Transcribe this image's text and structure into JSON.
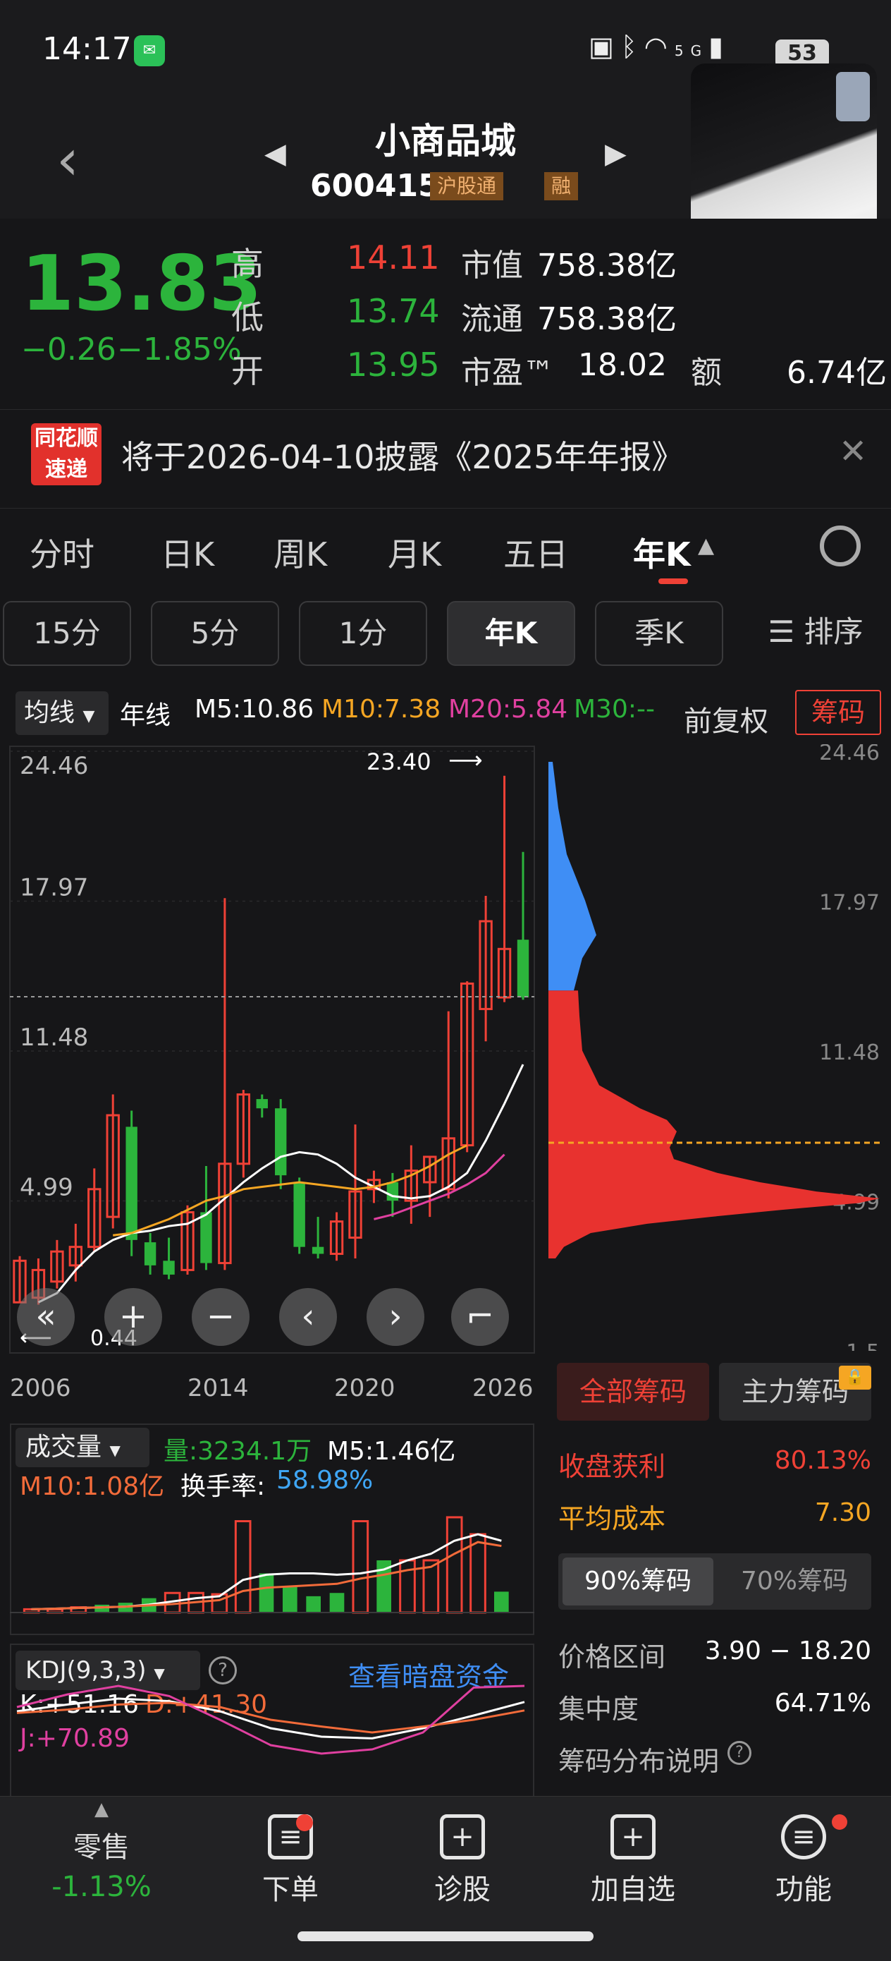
{
  "status": {
    "time": "14:17",
    "network": "5G",
    "battery": "53"
  },
  "header": {
    "name": "小商品城",
    "code": "600415",
    "tag1": "沪股通",
    "tag2": "融"
  },
  "quote": {
    "price": "13.83",
    "change": "−0.26",
    "change_pct": "−1.85%",
    "high_label": "高",
    "high": "14.11",
    "low_label": "低",
    "low": "13.74",
    "open_label": "开",
    "open": "13.95",
    "mcap_label": "市值",
    "mcap": "758.38亿",
    "float_label": "流通",
    "float": "758.38亿",
    "pe_label": "市盈™",
    "pe": "18.02",
    "amount_label": "额",
    "amount": "6.74亿"
  },
  "notice": {
    "logo_top": "同花顺",
    "logo_bottom": "速递",
    "text": "将于2026-04-10披露《2025年年报》"
  },
  "period_tabs": [
    "分时",
    "日K",
    "周K",
    "月K",
    "五日",
    "年K"
  ],
  "sub_tabs": [
    "15分",
    "5分",
    "1分",
    "年K",
    "季K",
    "☰ 排序"
  ],
  "ma_bar": {
    "selector": "均线",
    "type": "年线",
    "m5": "M5:10.86",
    "m10": "M10:7.38",
    "m20": "M20:5.84",
    "m30": "M30:--",
    "fq": "前复权",
    "chip": "筹码"
  },
  "colors": {
    "up": "#ef4136",
    "down": "#2cb43c",
    "m5": "#ffffff",
    "m10": "#f5a623",
    "m20": "#e040a0",
    "m30": "#2cb43c"
  },
  "chart_data": [
    {
      "type": "candlestick",
      "title": "年K",
      "y_ticks": [
        "24.46",
        "17.97",
        "11.48",
        "4.99"
      ],
      "x_ticks": [
        "2006",
        "2014",
        "2020",
        "2026"
      ],
      "ylim": [
        -1.5,
        24.46
      ],
      "max_label": "23.40",
      "min_label": "0.44",
      "reference_price": 13.83,
      "candles": [
        {
          "o": 0.6,
          "c": 2.4,
          "h": 2.6,
          "l": 0.6
        },
        {
          "o": 0.8,
          "c": 2.0,
          "h": 2.5,
          "l": 0.5
        },
        {
          "o": 1.5,
          "c": 2.8,
          "h": 3.3,
          "l": 1.2
        },
        {
          "o": 2.2,
          "c": 3.0,
          "h": 4.0,
          "l": 1.5
        },
        {
          "o": 3.0,
          "c": 5.5,
          "h": 6.4,
          "l": 2.8
        },
        {
          "o": 4.3,
          "c": 8.7,
          "h": 9.6,
          "l": 3.8
        },
        {
          "o": 8.2,
          "c": 3.3,
          "h": 8.9,
          "l": 2.6
        },
        {
          "o": 3.2,
          "c": 2.2,
          "h": 3.6,
          "l": 1.8
        },
        {
          "o": 2.4,
          "c": 1.8,
          "h": 3.4,
          "l": 1.6
        },
        {
          "o": 2.0,
          "c": 4.5,
          "h": 4.8,
          "l": 1.8
        },
        {
          "o": 4.5,
          "c": 2.3,
          "h": 6.5,
          "l": 2.0
        },
        {
          "o": 2.3,
          "c": 6.6,
          "h": 18.1,
          "l": 2.0
        },
        {
          "o": 6.6,
          "c": 9.6,
          "h": 9.8,
          "l": 6.0
        },
        {
          "o": 9.4,
          "c": 9.0,
          "h": 9.6,
          "l": 8.6
        },
        {
          "o": 9.0,
          "c": 6.1,
          "h": 9.4,
          "l": 5.5
        },
        {
          "o": 5.8,
          "c": 3.0,
          "h": 6.0,
          "l": 2.7
        },
        {
          "o": 3.0,
          "c": 2.7,
          "h": 4.3,
          "l": 2.5
        },
        {
          "o": 2.7,
          "c": 4.1,
          "h": 4.5,
          "l": 2.4
        },
        {
          "o": 3.4,
          "c": 5.4,
          "h": 8.3,
          "l": 2.5
        },
        {
          "o": 5.5,
          "c": 5.9,
          "h": 6.3,
          "l": 4.9
        },
        {
          "o": 5.8,
          "c": 5.0,
          "h": 6.2,
          "l": 4.3
        },
        {
          "o": 5.0,
          "c": 6.3,
          "h": 7.4,
          "l": 4.0
        },
        {
          "o": 5.8,
          "c": 6.9,
          "h": 6.9,
          "l": 4.3
        },
        {
          "o": 5.5,
          "c": 7.7,
          "h": 13.2,
          "l": 5.1
        },
        {
          "o": 7.4,
          "c": 14.4,
          "h": 14.5,
          "l": 7.1
        },
        {
          "o": 13.3,
          "c": 17.1,
          "h": 18.2,
          "l": 11.9
        },
        {
          "o": 13.8,
          "c": 15.9,
          "h": 23.4,
          "l": 13.6
        },
        {
          "o": 16.3,
          "c": 13.8,
          "h": 20.1,
          "l": 13.7
        }
      ],
      "ma_lines": [
        {
          "name": "M5",
          "start": 1,
          "values": [
            0.6,
            1.0,
            2.0,
            2.8,
            3.3,
            3.6,
            3.7,
            3.9,
            4.0,
            4.4,
            5.1,
            5.8,
            6.4,
            6.9,
            7.1,
            7.0,
            6.6,
            6.0,
            5.6,
            5.2,
            5.1,
            5.2,
            5.6,
            6.2,
            7.6,
            9.2,
            10.9
          ]
        },
        {
          "name": "M10",
          "start": 5,
          "values": [
            3.5,
            3.6,
            3.9,
            4.2,
            4.6,
            5.0,
            5.2,
            5.5,
            5.6,
            5.7,
            5.8,
            5.7,
            5.6,
            5.5,
            5.6,
            5.8,
            6.1,
            6.5,
            7.0,
            7.4
          ]
        },
        {
          "name": "M20",
          "start": 19,
          "values": [
            4.2,
            4.4,
            4.7,
            5.0,
            5.3,
            5.7,
            6.2,
            7.0
          ]
        }
      ]
    },
    {
      "type": "bar",
      "title": "成交量",
      "x": [
        2006,
        2007,
        2008,
        2009,
        2010,
        2011,
        2012,
        2013,
        2014,
        2015,
        2016,
        2017,
        2018,
        2019,
        2020,
        2021,
        2022,
        2023,
        2024,
        2025,
        2026
      ],
      "values": [
        0.05,
        0.05,
        0.08,
        0.12,
        0.15,
        0.22,
        0.3,
        0.3,
        0.28,
        1.4,
        0.6,
        0.4,
        0.25,
        0.3,
        1.4,
        0.8,
        0.8,
        0.8,
        1.46,
        1.2,
        0.32
      ],
      "up": [
        true,
        true,
        true,
        false,
        false,
        false,
        true,
        true,
        true,
        true,
        false,
        false,
        false,
        false,
        true,
        false,
        true,
        true,
        true,
        true,
        false
      ],
      "volume": "量:3234.1万",
      "m5": "M5:1.46亿",
      "m10": "M10:1.08亿",
      "turnover_label": "换手率:",
      "turnover": "58.98%"
    },
    {
      "type": "line",
      "title": "KDJ(9,3,3)",
      "series": [
        {
          "name": "K",
          "values": [
            40,
            48,
            55,
            52,
            40,
            20,
            10,
            8,
            20,
            35,
            51
          ]
        },
        {
          "name": "D",
          "values": [
            38,
            42,
            48,
            50,
            45,
            30,
            22,
            15,
            22,
            30,
            41
          ]
        },
        {
          "name": "J",
          "values": [
            45,
            60,
            70,
            58,
            30,
            0,
            -10,
            -5,
            15,
            68,
            70
          ]
        }
      ],
      "k": "K:+51.16",
      "d": "D:+41.30",
      "j": "J:+70.89",
      "link": "查看暗盘资金"
    }
  ],
  "chip_panel": {
    "axis": [
      "24.46",
      "17.97",
      "11.48",
      "4.99",
      "-1.5"
    ],
    "tabs": [
      "全部筹码",
      "主力筹码"
    ],
    "profit_label": "收盘获利",
    "profit": "80.13%",
    "cost_label": "平均成本",
    "cost": "7.30",
    "sub_tabs": [
      "90%筹码",
      "70%筹码"
    ],
    "range_label": "价格区间",
    "range": "3.90 − 18.20",
    "conc_label": "集中度",
    "conc": "64.71%",
    "desc_label": "筹码分布说明"
  },
  "bottom_nav": {
    "retail": "零售",
    "retail_pct": "-1.13%",
    "items": [
      "下单",
      "诊股",
      "加自选",
      "功能"
    ]
  }
}
